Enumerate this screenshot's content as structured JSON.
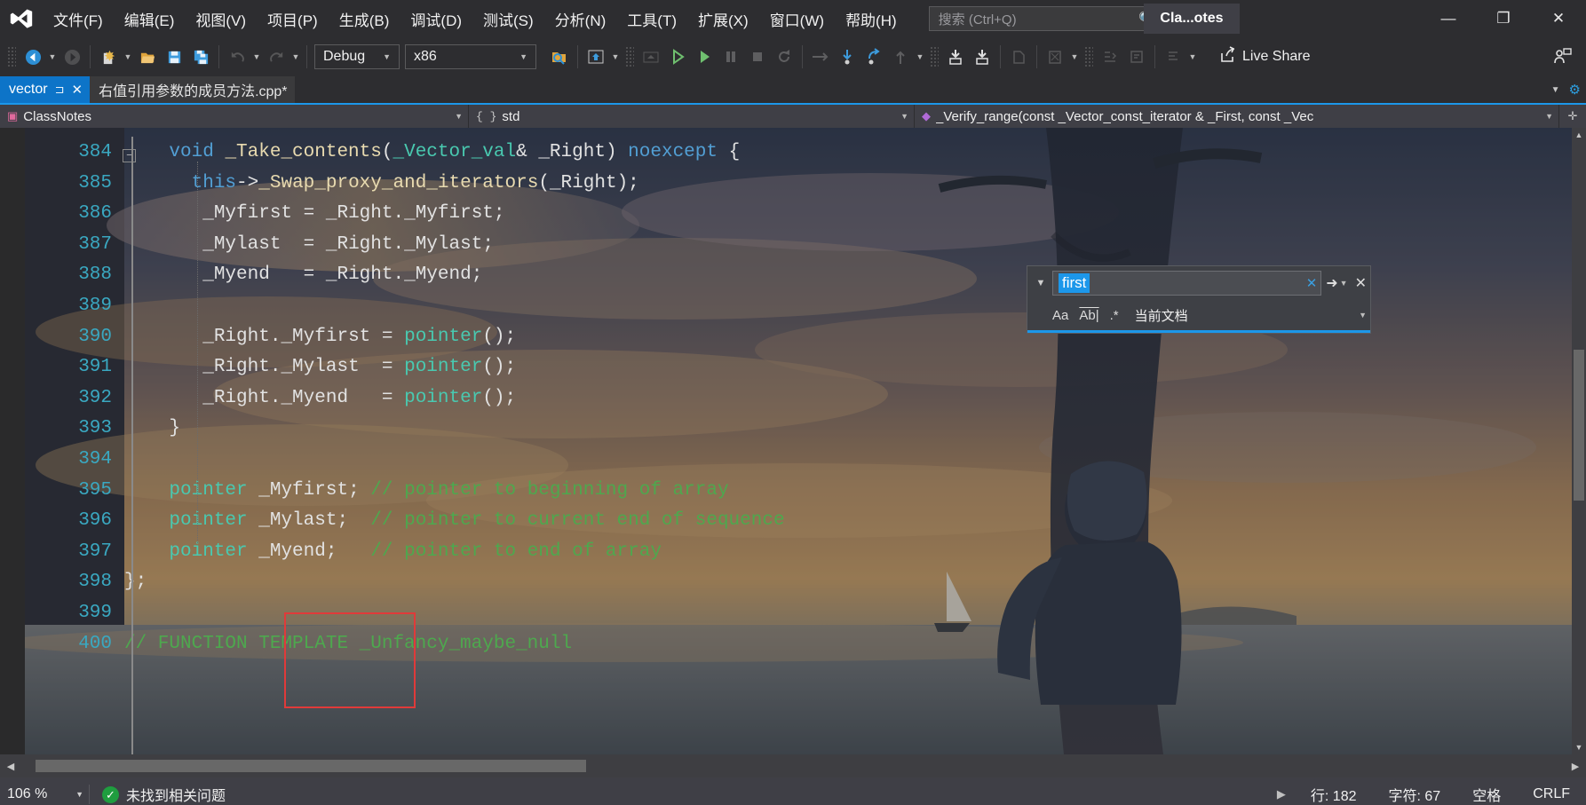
{
  "titlebar": {
    "logo_icon": "visual-studio-logo",
    "menus": [
      {
        "label": "文件(F)"
      },
      {
        "label": "编辑(E)"
      },
      {
        "label": "视图(V)"
      },
      {
        "label": "项目(P)"
      },
      {
        "label": "生成(B)"
      },
      {
        "label": "调试(D)"
      },
      {
        "label": "测试(S)"
      },
      {
        "label": "分析(N)"
      },
      {
        "label": "工具(T)"
      },
      {
        "label": "扩展(X)"
      },
      {
        "label": "窗口(W)"
      },
      {
        "label": "帮助(H)"
      }
    ],
    "search": {
      "placeholder": "搜索 (Ctrl+Q)",
      "value": "",
      "icon": "search-icon"
    },
    "window_title": "Cla...otes",
    "minimize": "—",
    "restore": "❐",
    "close": "✕"
  },
  "toolbar": {
    "nav_back": "back-arrow-icon",
    "nav_forward": "forward-arrow-icon",
    "new_item": "new-item-icon",
    "open_file": "open-folder-icon",
    "save": "save-icon",
    "save_all": "save-all-icon",
    "undo": "undo-icon",
    "redo": "redo-icon",
    "config": {
      "label": "Debug"
    },
    "platform": {
      "label": "x86"
    },
    "find_in_files": "find-in-files-icon",
    "solution_explorer": "solution-explorer-icon",
    "attach": "attach-icon",
    "start_debug": "start-debug-icon",
    "start_no_debug": "start-without-debugging-icon",
    "pause": "pause-icon",
    "stop": "stop-icon",
    "restart": "restart-icon",
    "step_over_arrow": "step-over-icon",
    "step_into": "step-into-icon",
    "step_out_curve": "step-out-icon",
    "step_up": "step-up-icon",
    "bookmark_1": "bookmark-icon",
    "bookmark_2": "bookmark-next-icon",
    "indent": "indent-icon",
    "comment": "comment-icon",
    "uncomment": "uncomment-icon",
    "live_share": {
      "label": "Live Share",
      "icon": "live-share-icon"
    },
    "live_share_panel": "live-share-panel-icon"
  },
  "tabs": [
    {
      "label": "vector",
      "active": true,
      "pin": "pin-icon",
      "close": "✕"
    },
    {
      "label": "右值引用参数的成员方法.cpp*",
      "active": false
    }
  ],
  "tabstrip_right": {
    "overflow": "chevron-down-icon",
    "settings": "gear-icon"
  },
  "navbar": {
    "project": {
      "label": "ClassNotes",
      "icon": "project-icon"
    },
    "namespace": {
      "label": "std",
      "icon": "braces-icon"
    },
    "member": {
      "label": "_Verify_range(const _Vector_const_iterator & _First, const _Vec",
      "icon": "method-icon"
    },
    "split_icon": "split-editor-icon"
  },
  "find": {
    "expand_icon": "chevron-down-icon",
    "query": "first",
    "clear_icon": "clear-icon",
    "next_icon": "find-next-icon",
    "options_caret": "chevron-down-icon",
    "close_icon": "close-icon",
    "match_case": "Aa",
    "match_word": "Ab|",
    "use_regex": ".*",
    "scope": "当前文档"
  },
  "editor": {
    "collapse_marker": "−",
    "lines": [
      {
        "num": "384",
        "tokens": [
          {
            "t": "void ",
            "c": "k"
          },
          {
            "t": "_Take_contents",
            "c": "fn"
          },
          {
            "t": "(",
            "c": "pn"
          },
          {
            "t": "_Vector_val",
            "c": "ty"
          },
          {
            "t": "& ",
            "c": "pn"
          },
          {
            "t": "_Right",
            "c": "id"
          },
          {
            "t": ") ",
            "c": "pn"
          },
          {
            "t": "noexcept",
            "c": "k"
          },
          {
            "t": " {",
            "c": "pn"
          }
        ],
        "indent": 4
      },
      {
        "num": "385",
        "tokens": [
          {
            "t": "this",
            "c": "k"
          },
          {
            "t": "->",
            "c": "pn"
          },
          {
            "t": "_Swap_proxy_and_iterators",
            "c": "fn"
          },
          {
            "t": "(",
            "c": "pn"
          },
          {
            "t": "_Right",
            "c": "id"
          },
          {
            "t": ");",
            "c": "pn"
          }
        ],
        "indent": 6
      },
      {
        "num": "386",
        "tokens": [
          {
            "t": "_Myfirst ",
            "c": "id"
          },
          {
            "t": "= ",
            "c": "pn"
          },
          {
            "t": "_Right",
            "c": "id"
          },
          {
            "t": ".",
            "c": "pn"
          },
          {
            "t": "_Myfirst",
            "c": "id"
          },
          {
            "t": ";",
            "c": "pn"
          }
        ],
        "indent": 7
      },
      {
        "num": "387",
        "tokens": [
          {
            "t": "_Mylast  ",
            "c": "id"
          },
          {
            "t": "= ",
            "c": "pn"
          },
          {
            "t": "_Right",
            "c": "id"
          },
          {
            "t": ".",
            "c": "pn"
          },
          {
            "t": "_Mylast",
            "c": "id"
          },
          {
            "t": ";",
            "c": "pn"
          }
        ],
        "indent": 7
      },
      {
        "num": "388",
        "tokens": [
          {
            "t": "_Myend   ",
            "c": "id"
          },
          {
            "t": "= ",
            "c": "pn"
          },
          {
            "t": "_Right",
            "c": "id"
          },
          {
            "t": ".",
            "c": "pn"
          },
          {
            "t": "_Myend",
            "c": "id"
          },
          {
            "t": ";",
            "c": "pn"
          }
        ],
        "indent": 7
      },
      {
        "num": "389",
        "tokens": [],
        "indent": 0
      },
      {
        "num": "390",
        "tokens": [
          {
            "t": "_Right",
            "c": "id"
          },
          {
            "t": ".",
            "c": "pn"
          },
          {
            "t": "_Myfirst ",
            "c": "id"
          },
          {
            "t": "= ",
            "c": "pn"
          },
          {
            "t": "pointer",
            "c": "ty"
          },
          {
            "t": "();",
            "c": "pn"
          }
        ],
        "indent": 7
      },
      {
        "num": "391",
        "tokens": [
          {
            "t": "_Right",
            "c": "id"
          },
          {
            "t": ".",
            "c": "pn"
          },
          {
            "t": "_Mylast  ",
            "c": "id"
          },
          {
            "t": "= ",
            "c": "pn"
          },
          {
            "t": "pointer",
            "c": "ty"
          },
          {
            "t": "();",
            "c": "pn"
          }
        ],
        "indent": 7
      },
      {
        "num": "392",
        "tokens": [
          {
            "t": "_Right",
            "c": "id"
          },
          {
            "t": ".",
            "c": "pn"
          },
          {
            "t": "_Myend   ",
            "c": "id"
          },
          {
            "t": "= ",
            "c": "pn"
          },
          {
            "t": "pointer",
            "c": "ty"
          },
          {
            "t": "();",
            "c": "pn"
          }
        ],
        "indent": 7
      },
      {
        "num": "393",
        "tokens": [
          {
            "t": "}",
            "c": "pn"
          }
        ],
        "indent": 4
      },
      {
        "num": "394",
        "tokens": [],
        "indent": 0
      },
      {
        "num": "395",
        "tokens": [
          {
            "t": "pointer ",
            "c": "ty"
          },
          {
            "t": "_Myfirst; ",
            "c": "id"
          },
          {
            "t": "// pointer to beginning of array",
            "c": "cm"
          }
        ],
        "indent": 4
      },
      {
        "num": "396",
        "tokens": [
          {
            "t": "pointer ",
            "c": "ty"
          },
          {
            "t": "_Mylast;  ",
            "c": "id"
          },
          {
            "t": "// pointer to current end of sequence",
            "c": "cm"
          }
        ],
        "indent": 4
      },
      {
        "num": "397",
        "tokens": [
          {
            "t": "pointer ",
            "c": "ty"
          },
          {
            "t": "_Myend;   ",
            "c": "id"
          },
          {
            "t": "// pointer to end of array",
            "c": "cm"
          }
        ],
        "indent": 4
      },
      {
        "num": "398",
        "tokens": [
          {
            "t": "};",
            "c": "pn"
          }
        ],
        "indent": 0
      },
      {
        "num": "399",
        "tokens": [],
        "indent": 0
      },
      {
        "num": "400",
        "tokens": [
          {
            "t": "// FUNCTION TEMPLATE _Unfancy_maybe_null",
            "c": "cm"
          }
        ],
        "indent": 0
      }
    ],
    "annotation": {
      "name": "red-highlight-box",
      "color": "#e03a3a"
    }
  },
  "statusbar": {
    "zoom": "106 %",
    "issues_icon": "check-circle-icon",
    "issues": "未找到相关问题",
    "line": "行: 182",
    "col": "字符: 67",
    "indent": "空格",
    "eol": "CRLF"
  }
}
